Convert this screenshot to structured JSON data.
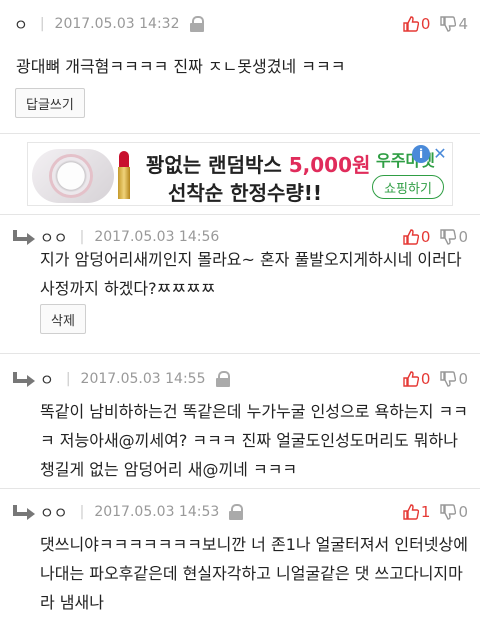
{
  "comments": [
    {
      "nick": "ㅇ",
      "date": "2017.05.03 14:32",
      "up": "0",
      "down": "4",
      "text": "광대뼈 개극혐ㅋㅋㅋㅋ 진짜 ㅈㄴ못생겼네 ㅋㅋㅋ",
      "button": "답글쓰기"
    },
    {
      "nick": "ㅇㅇ",
      "date": "2017.05.03 14:56",
      "up": "0",
      "down": "0",
      "text": "지가 암덩어리새끼인지 몰라요~ 혼자 풀발오지게하시네 이러다 사정까지 하겠다?ㅉㅉㅉㅉ",
      "button": "삭제"
    },
    {
      "nick": "ㅇ",
      "date": "2017.05.03 14:55",
      "up": "0",
      "down": "0",
      "text": "똑같이 남비하하는건 똑같은데 누가누굴 인성으로 욕하는지 ㅋㅋㅋ 저능아새@끼세여? ㅋㅋㅋ 진짜 얼굴도인성도머리도 뭐하나 챙길게 없는 암덩어리 새@끼네 ㅋㅋㅋ"
    },
    {
      "nick": "ㅇㅇ",
      "date": "2017.05.03 14:53",
      "up": "1",
      "down": "0",
      "text": "댓쓰니야ㅋㅋㅋㅋㅋㅋㅋ보니깐 너 존1나 얼굴터져서 인터넷상에 나대는 파오후같은데 현실자각하고 니얼굴같은 댓 쓰고다니지마라 냄새나"
    }
  ],
  "ad": {
    "headline_prefix": "꽝없는 랜덤박스 ",
    "headline_price": "5,000원",
    "headline_line2": "선착순 한정수량!!",
    "brand": "우주마켓",
    "shop_button": "쇼핑하기",
    "info_symbol": "i",
    "close_symbol": "✕"
  },
  "colors": {
    "upvote": "#e53935",
    "downvote": "#999999",
    "ad_accent": "#e02c5b",
    "ad_brand": "#2f9e44"
  }
}
